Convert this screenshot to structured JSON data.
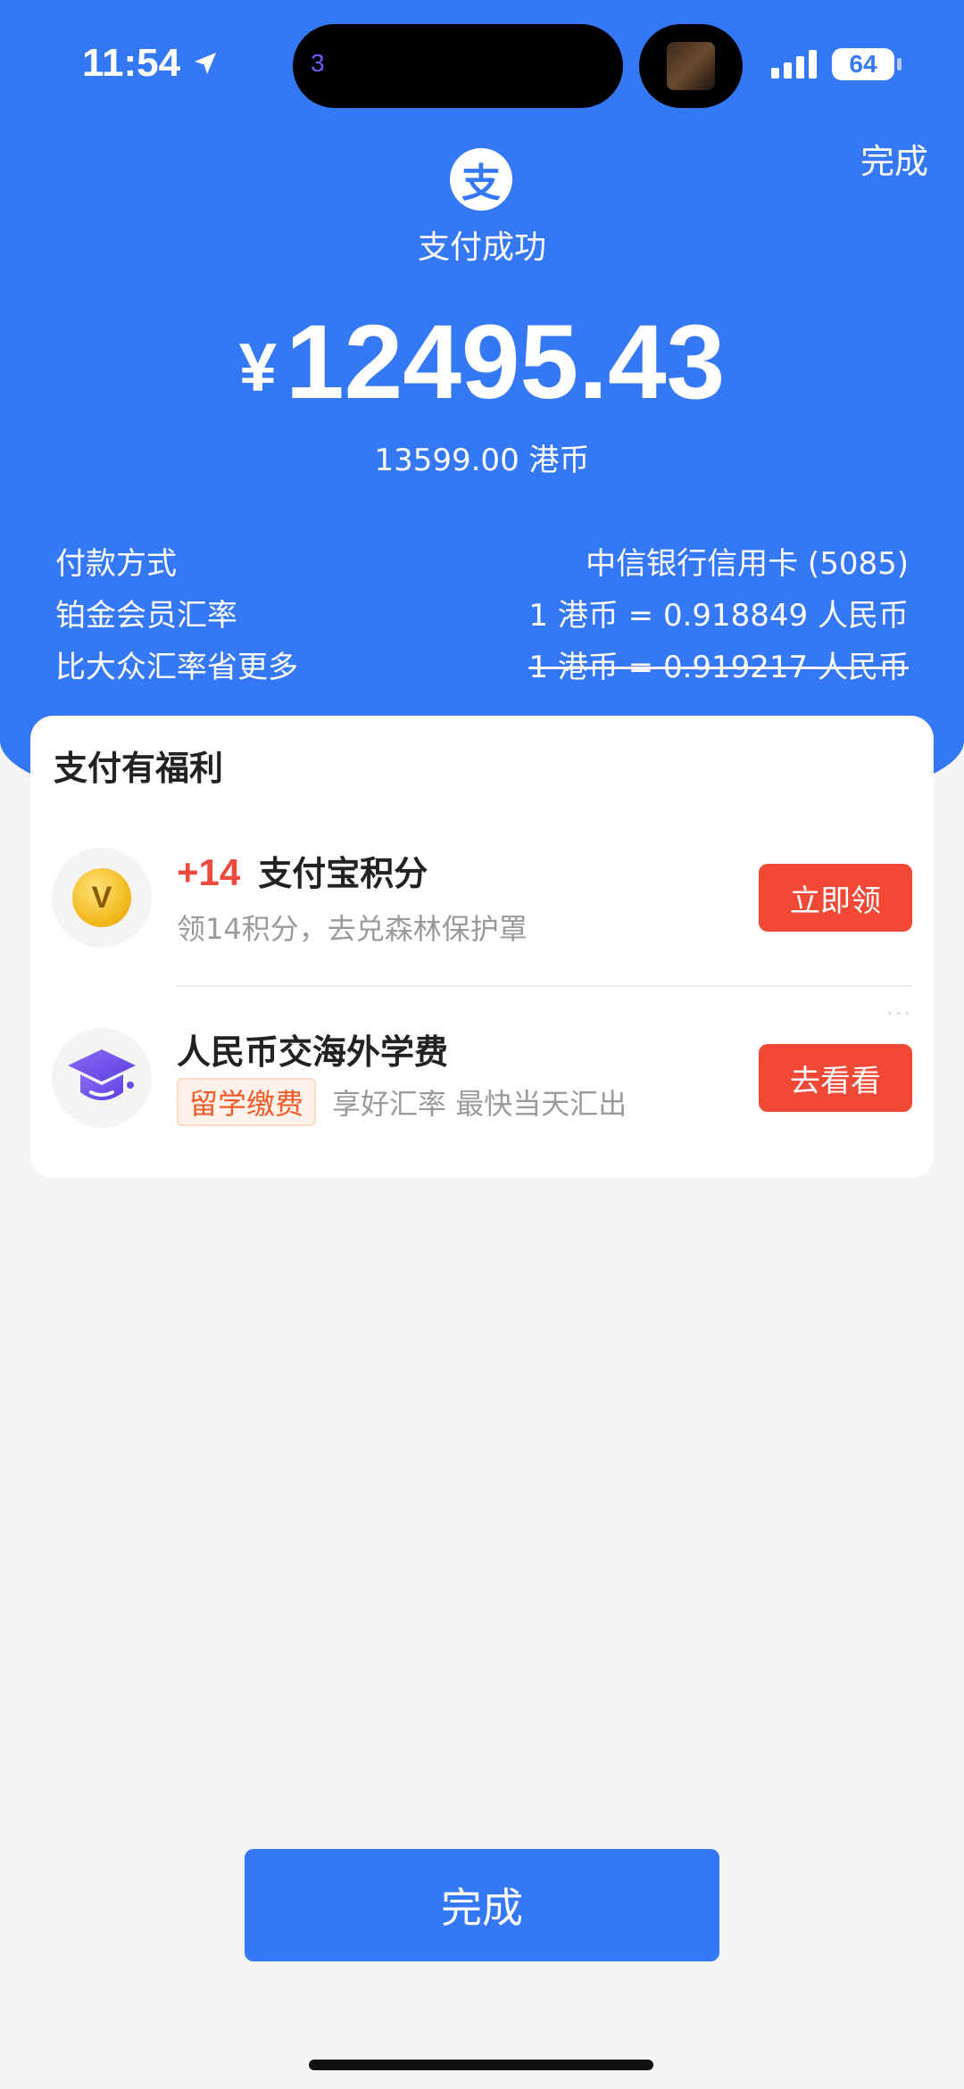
{
  "status_bar": {
    "time": "11:54",
    "island_number": "3",
    "battery": "64"
  },
  "header": {
    "done_link": "完成",
    "logo_char": "支",
    "status": "支付成功",
    "currency_symbol": "¥",
    "amount": "12495.43",
    "original_amount": "13599.00 港币"
  },
  "info_rows": [
    {
      "label": "付款方式",
      "value": "中信银行信用卡 (5085)"
    },
    {
      "label": "铂金会员汇率",
      "value": "1 港币 = 0.918849 人民币"
    },
    {
      "label": "比大众汇率省更多",
      "value": "1 港币 = 0.919217 人民币",
      "struck": true
    }
  ],
  "benefits": {
    "title": "支付有福利",
    "items": [
      {
        "plus": "+14",
        "title": "支付宝积分",
        "subtitle": "领14积分，去兑森林保护罩",
        "button": "立即领",
        "icon": "coin-icon"
      },
      {
        "title": "人民币交海外学费",
        "tag": "留学缴费",
        "subtitle": "享好汇率 最快当天汇出",
        "button": "去看看",
        "icon": "graduation-cap-icon"
      }
    ],
    "more": "···"
  },
  "footer": {
    "complete_button": "完成"
  },
  "colors": {
    "brand_blue": "#3478f6",
    "action_red": "#f24936",
    "tag_orange": "#f25a27",
    "background": "#f5f5f5"
  }
}
